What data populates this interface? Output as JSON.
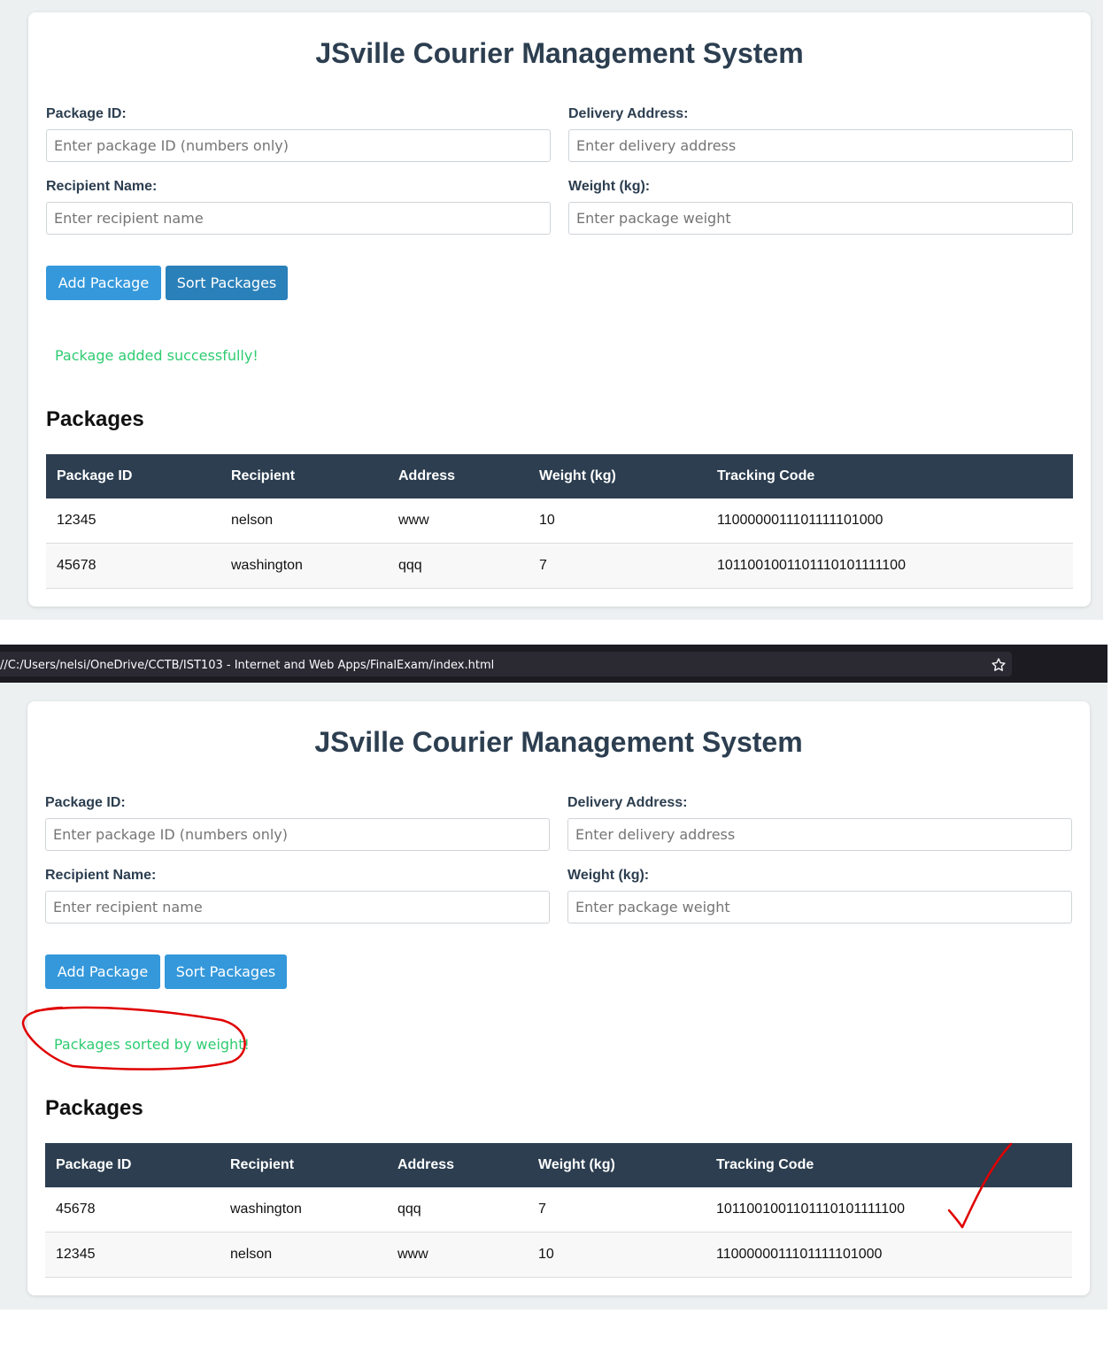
{
  "app": {
    "title": "JSville Courier Management System",
    "form": {
      "package_id_label": "Package ID:",
      "package_id_placeholder": "Enter package ID (numbers only)",
      "address_label": "Delivery Address:",
      "address_placeholder": "Enter delivery address",
      "recipient_label": "Recipient Name:",
      "recipient_placeholder": "Enter recipient name",
      "weight_label": "Weight (kg):",
      "weight_placeholder": "Enter package weight"
    },
    "buttons": {
      "add": "Add Package",
      "sort": "Sort Packages"
    },
    "packages_heading": "Packages",
    "columns": [
      "Package ID",
      "Recipient",
      "Address",
      "Weight (kg)",
      "Tracking Code"
    ]
  },
  "screen1": {
    "status_message": "Package added successfully!",
    "rows": [
      [
        "12345",
        "nelson",
        "www",
        "10",
        "1100000011101111101000"
      ],
      [
        "45678",
        "washington",
        "qqq",
        "7",
        "1011001001101110101111100"
      ]
    ]
  },
  "browser": {
    "url": "//C:/Users/nelsi/OneDrive/CCTB/IST103 - Internet and Web Apps/FinalExam/index.html",
    "bookmark_icon": "star-outline-icon"
  },
  "screen2": {
    "status_message": "Packages sorted by weight!",
    "rows": [
      [
        "45678",
        "washington",
        "qqq",
        "7",
        "1011001001101110101111100"
      ],
      [
        "12345",
        "nelson",
        "www",
        "10",
        "1100000011101111101000"
      ]
    ]
  },
  "annotations": {
    "circle_color": "#e00000",
    "checkmark_color": "#e00000"
  }
}
